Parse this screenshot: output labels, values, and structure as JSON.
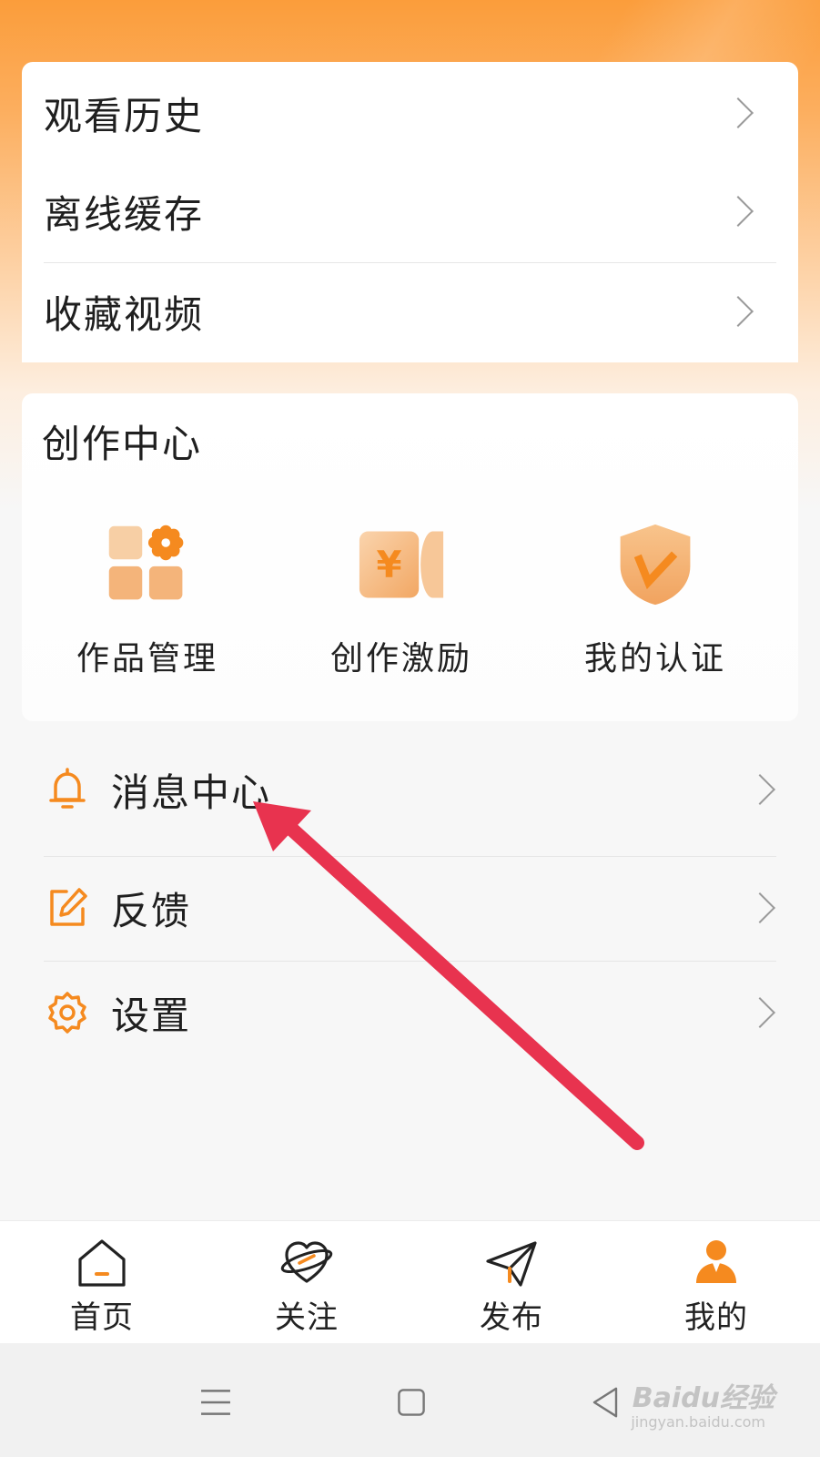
{
  "history_menu": {
    "items": [
      {
        "label": "观看历史"
      },
      {
        "label": "离线缓存"
      },
      {
        "label": "收藏视频"
      }
    ]
  },
  "creation_center": {
    "title": "创作中心",
    "items": [
      {
        "label": "作品管理",
        "icon": "works-grid-icon"
      },
      {
        "label": "创作激励",
        "icon": "yen-coupon-icon"
      },
      {
        "label": "我的认证",
        "icon": "verified-shield-icon"
      }
    ]
  },
  "settings_menu": {
    "items": [
      {
        "label": "消息中心",
        "icon": "bell-icon"
      },
      {
        "label": "反馈",
        "icon": "edit-icon"
      },
      {
        "label": "设置",
        "icon": "gear-icon"
      }
    ]
  },
  "tabbar": {
    "tabs": [
      {
        "label": "首页",
        "icon": "home-icon",
        "active": false
      },
      {
        "label": "关注",
        "icon": "heart-planet-icon",
        "active": false
      },
      {
        "label": "发布",
        "icon": "paper-plane-icon",
        "active": false
      },
      {
        "label": "我的",
        "icon": "person-icon",
        "active": true
      }
    ]
  },
  "watermark": {
    "brand": "Baidu经验",
    "url": "jingyan.baidu.com"
  },
  "colors": {
    "accent": "#f58a1f",
    "header_gradient_start": "#fb9d3b",
    "annotation_arrow": "#e8334f"
  }
}
